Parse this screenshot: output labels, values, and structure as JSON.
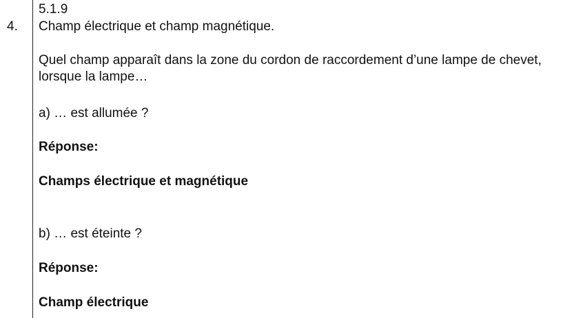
{
  "question": {
    "section_ref": "5.1.9",
    "number": "4.",
    "title": "Champ électrique et champ magnétique.",
    "prompt": "Quel champ apparaît dans la zone du cordon de raccordement d’une lampe de chevet, lorsque la lampe…",
    "parts": [
      {
        "label": "a)  … est allumée ?",
        "answer_label": "Réponse:",
        "answer": "Champs électrique et magnétique"
      },
      {
        "label": "b)  … est éteinte ?",
        "answer_label": "Réponse:",
        "answer": "Champ électrique"
      }
    ]
  }
}
